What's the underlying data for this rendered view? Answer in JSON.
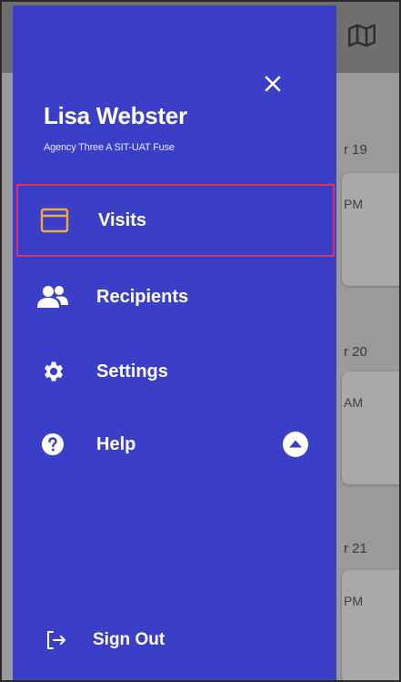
{
  "background": {
    "dates": [
      "r 19",
      "r 20",
      "r 21"
    ],
    "times": [
      "PM",
      "AM",
      "PM"
    ]
  },
  "drawer": {
    "user": {
      "name": "Lisa Webster",
      "agency": "Agency Three A SIT-UAT Fuse"
    },
    "nav": [
      {
        "label": "Visits",
        "icon": "calendar-icon",
        "active": true
      },
      {
        "label": "Recipients",
        "icon": "people-icon",
        "active": false
      },
      {
        "label": "Settings",
        "icon": "gear-icon",
        "active": false
      },
      {
        "label": "Help",
        "icon": "help-icon",
        "active": false
      }
    ],
    "sign_out": {
      "label": "Sign Out",
      "icon": "sign-out-icon"
    }
  },
  "colors": {
    "drawer_bg": "#3b3fc8",
    "active_border": "#d7346a",
    "calendar_icon": "#f0a93a",
    "overlay": "#8d8d8d"
  }
}
